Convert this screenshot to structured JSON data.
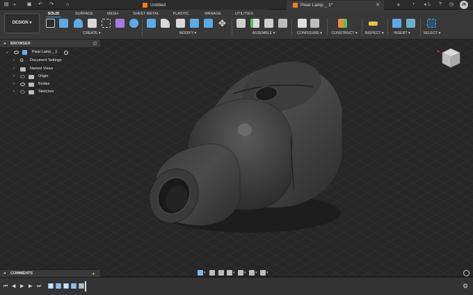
{
  "tabs": {
    "untitled": "Untitled",
    "pixar": "Pixar Lamp _ 1*",
    "close_glyph": "✕"
  },
  "user": {
    "initials": "JK",
    "notifications": "1"
  },
  "toolbar": {
    "workspace": "DESIGN",
    "workspace_tabs": [
      "SOLID",
      "SURFACE",
      "MESH",
      "SHEET METAL",
      "PLASTIC",
      "MANAGE",
      "UTILITIES"
    ],
    "active_tab": "SOLID",
    "groups": [
      "CREATE",
      "MODIFY",
      "ASSEMBLE",
      "CONFIGURE",
      "CONSTRUCT",
      "INSPECT",
      "INSERT",
      "SELECT"
    ],
    "dropdown_glyph": "▾"
  },
  "browser": {
    "title": "BROWSER",
    "root": "Pixar Lamp _ 1",
    "items": [
      "Document Settings",
      "Named Views",
      "Origin",
      "Bodies",
      "Sketches"
    ]
  },
  "comments": {
    "title": "COMMENTS",
    "add": "+"
  },
  "colors": {
    "accent": "#3e95e6",
    "tab_logo": "#f0801e",
    "viewport_bg": "#262626",
    "toolbar_bg": "#383838",
    "model": "#4a4a4a"
  }
}
